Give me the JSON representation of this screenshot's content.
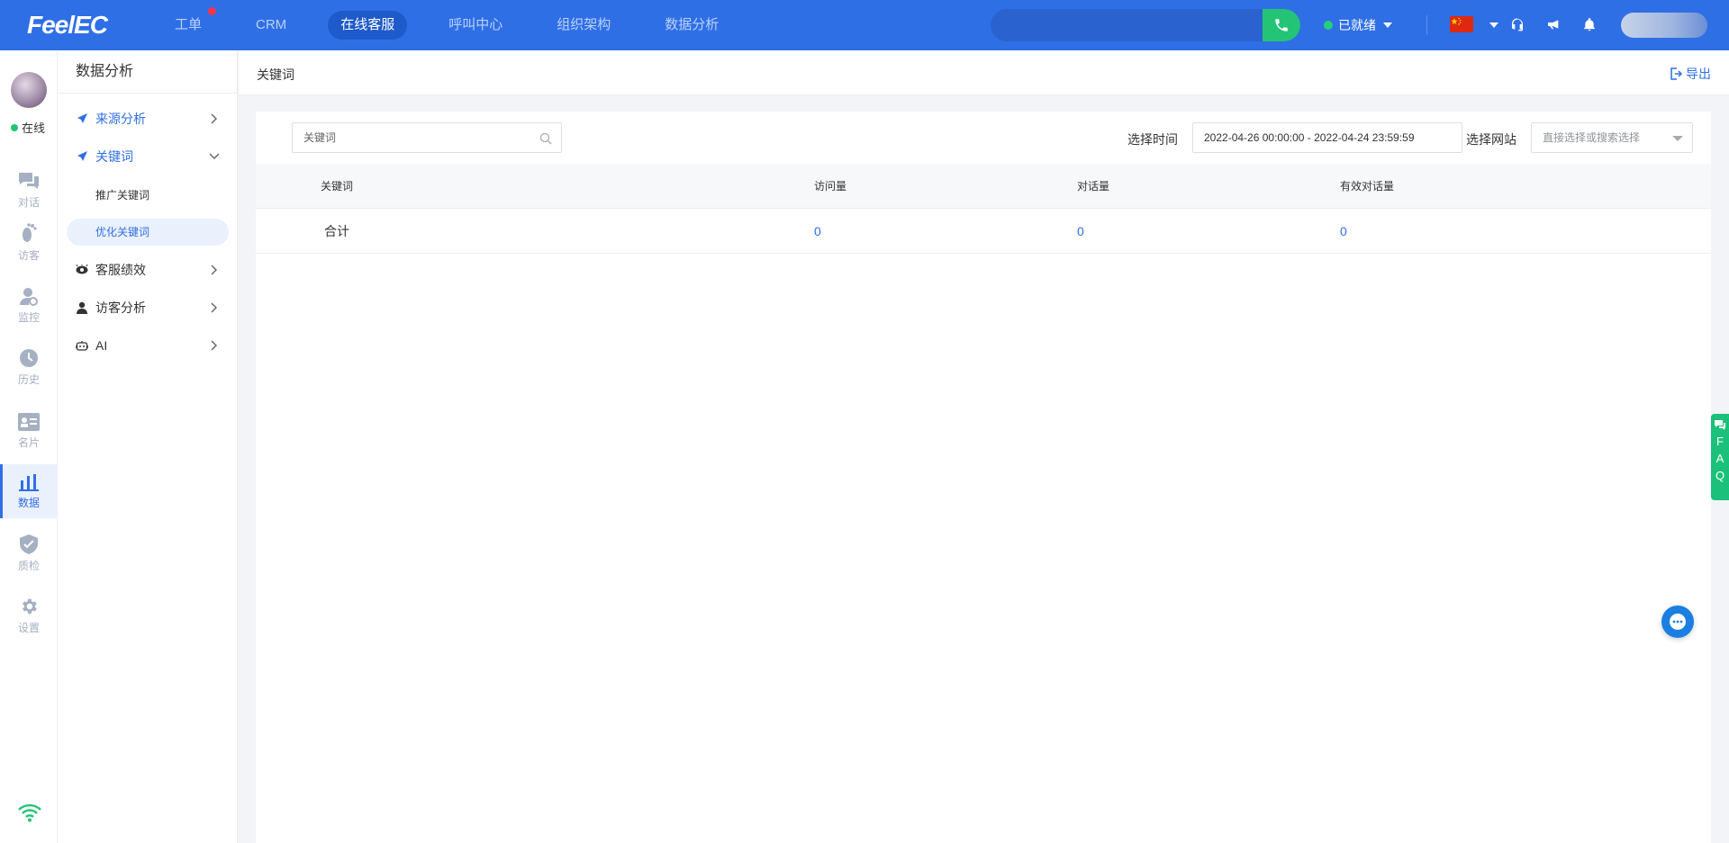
{
  "brand": {
    "logo": "FeelEC"
  },
  "nav": {
    "items": [
      {
        "label": "工单",
        "badge": true,
        "active": false
      },
      {
        "label": "CRM",
        "active": false
      },
      {
        "label": "在线客服",
        "active": true
      },
      {
        "label": "呼叫中心",
        "active": false
      },
      {
        "label": "组织架构",
        "active": false
      },
      {
        "label": "数据分析",
        "active": false
      }
    ]
  },
  "topbar": {
    "search_placeholder": "",
    "status_label": "已就绪"
  },
  "rail": {
    "online_label": "在线",
    "items": [
      {
        "label": "对话",
        "icon": "chat-icon"
      },
      {
        "label": "访客",
        "icon": "footprint-icon"
      },
      {
        "label": "监控",
        "icon": "monitor-user-icon"
      },
      {
        "label": "历史",
        "icon": "clock-icon"
      },
      {
        "label": "名片",
        "icon": "id-card-icon"
      },
      {
        "label": "数据",
        "icon": "bar-chart-icon",
        "active": true
      },
      {
        "label": "质检",
        "icon": "shield-check-icon"
      },
      {
        "label": "设置",
        "icon": "gear-icon"
      }
    ]
  },
  "submenu": {
    "title": "数据分析",
    "items": [
      {
        "label": "来源分析",
        "icon": "compass-icon"
      },
      {
        "label": "关键词",
        "icon": "compass-icon",
        "open": true
      },
      {
        "label": "客服绩效",
        "icon": "eye-icon"
      },
      {
        "label": "访客分析",
        "icon": "person-icon"
      },
      {
        "label": "AI",
        "icon": "robot-icon"
      }
    ],
    "sub_items": [
      {
        "label": "推广关键词"
      },
      {
        "label": "优化关键词",
        "active": true
      }
    ]
  },
  "content": {
    "title": "关键词",
    "export_label": "导出"
  },
  "filters": {
    "keyword_placeholder": "关键词",
    "time_label": "选择时间",
    "date_range": "2022-04-26 00:00:00 - 2022-04-24 23:59:59",
    "site_label": "选择网站",
    "site_placeholder": "直接选择或搜索选择"
  },
  "table": {
    "headers": [
      "关键词",
      "访问量",
      "对话量",
      "有效对话量"
    ],
    "rows": [
      [
        "合计",
        "0",
        "0",
        "0"
      ]
    ]
  },
  "faq": {
    "letters": [
      "F",
      "A",
      "Q"
    ]
  },
  "colors": {
    "primary": "#2f6fe6",
    "success": "#23c476",
    "badge": "#f5334b"
  }
}
